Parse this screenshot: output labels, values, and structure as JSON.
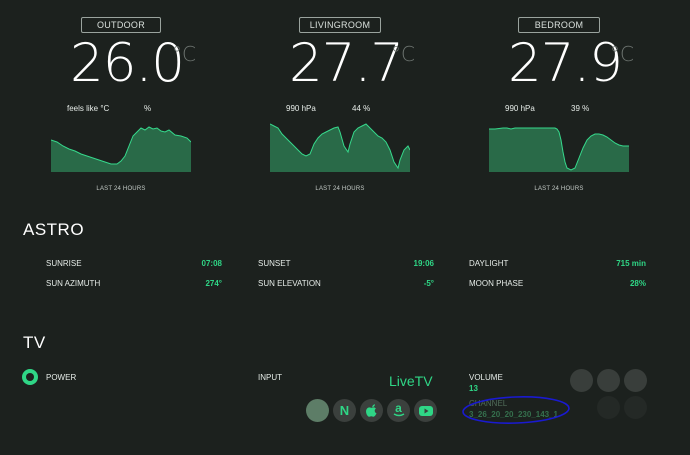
{
  "rooms": [
    {
      "label": "OUTDOOR",
      "temp": "26.0",
      "unit": "°C",
      "info_left": "feels like °C",
      "info_right": "%",
      "period": "LAST 24 HOURS"
    },
    {
      "label": "LIVINGROOM",
      "temp": "27.7",
      "unit": "°C",
      "info_left": "990 hPa",
      "info_right": "44 %",
      "period": "LAST 24 HOURS"
    },
    {
      "label": "BEDROOM",
      "temp": "27.9",
      "unit": "°C",
      "info_left": "990 hPa",
      "info_right": "39 %",
      "period": "LAST 24 HOURS"
    }
  ],
  "astro": {
    "title": "ASTRO",
    "items": [
      {
        "label": "SUNRISE",
        "value": "07:08"
      },
      {
        "label": "SUNSET",
        "value": "19:06"
      },
      {
        "label": "DAYLIGHT",
        "value": "715 min"
      },
      {
        "label": "SUN AZIMUTH",
        "value": "274°"
      },
      {
        "label": "SUN ELEVATION",
        "value": "-5°"
      },
      {
        "label": "MOON PHASE",
        "value": "28%"
      }
    ]
  },
  "tv": {
    "title": "TV",
    "power_label": "POWER",
    "input_label": "INPUT",
    "input_value": "LiveTV",
    "volume_label": "VOLUME",
    "volume_value": "13",
    "channel_label": "CHANNEL",
    "channel_value": "3_26_20_20_230_143_1",
    "inputs": [
      "live-tv-icon",
      "netflix-icon",
      "apple-icon",
      "amazon-icon",
      "youtube-icon"
    ],
    "input_glyphs": {
      "netflix": "N",
      "amazon": "a"
    }
  },
  "colors": {
    "accent": "#2fd686",
    "background": "#1c211e",
    "annotation": "#1a1ad0"
  }
}
